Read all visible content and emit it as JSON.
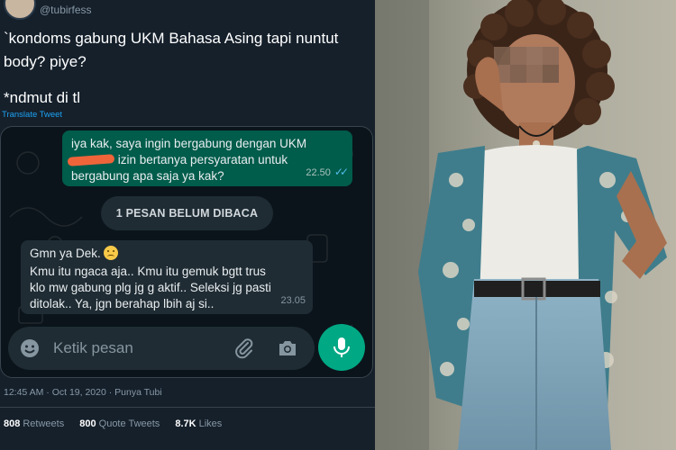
{
  "tweet": {
    "handle": "@tubirfess",
    "text_line1": "`kondoms gabung UKM Bahasa Asing tapi nuntut body? piye?",
    "text_line2": "*ndmut di tl",
    "translate": "Translate Tweet",
    "timestamp": "12:45 AM · Oct 19, 2020 · Punya Tubi",
    "stats": {
      "retweets_count": "808",
      "retweets_label": "Retweets",
      "quotes_count": "800",
      "quotes_label": "Quote Tweets",
      "likes_count": "8.7K",
      "likes_label": "Likes"
    }
  },
  "whatsapp": {
    "outgoing": {
      "text_a": "iya kak, saya ingin bergabung dengan UKM",
      "text_b": "izin bertanya persyaratan untuk bergabung apa saja ya kak?",
      "time": "22.50"
    },
    "unread_banner": "1 PESAN BELUM DIBACA",
    "incoming": {
      "line1": "Gmn ya Dek.",
      "body": "Kmu itu ngaca aja.. Kmu itu gemuk bgtt trus klo mw gabung plg jg g aktif.. Seleksi jg pasti ditolak.. Ya, jgn berahap lbih aj si..",
      "time": "23.05"
    },
    "composer_placeholder": "Ketik pesan"
  },
  "icons": [
    "emoji-icon",
    "attach-icon",
    "camera-icon",
    "mic-icon",
    "read-ticks-icon"
  ],
  "colors": {
    "twitter_bg": "#15202b",
    "wa_bg": "#0b141a",
    "bubble_out": "#005c4b",
    "bubble_in": "#1f2c34",
    "accent_green": "#00a884",
    "link_blue": "#1da1f2"
  }
}
